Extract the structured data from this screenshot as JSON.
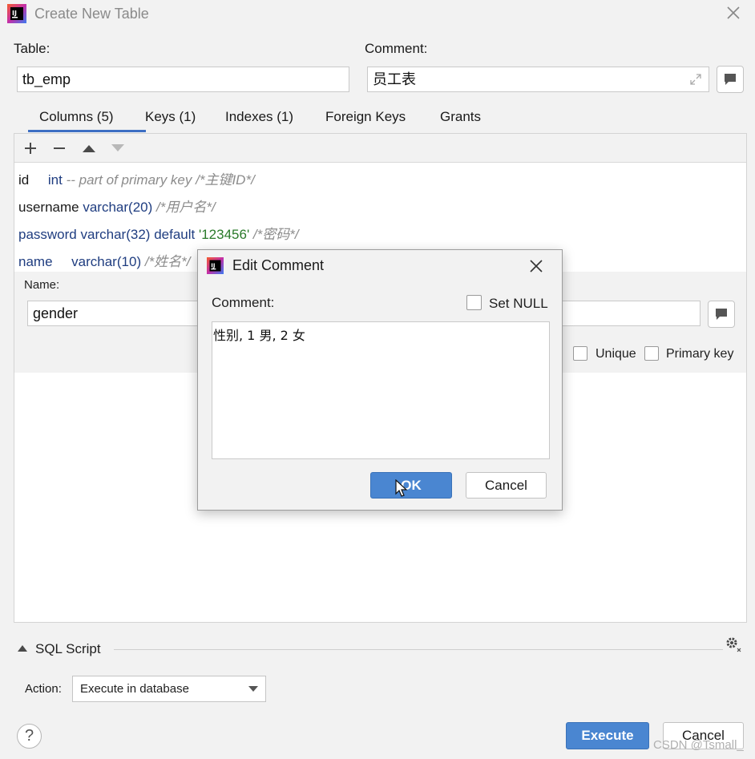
{
  "window": {
    "title": "Create New Table"
  },
  "table": {
    "label": "Table:",
    "value": "tb_emp"
  },
  "comment": {
    "label": "Comment:",
    "value": "员工表"
  },
  "tabs": [
    {
      "label": "Columns (5)"
    },
    {
      "label": "Keys (1)"
    },
    {
      "label": "Indexes (1)"
    },
    {
      "label": "Foreign Keys"
    },
    {
      "label": "Grants"
    }
  ],
  "columns": [
    {
      "name": "id",
      "type": "int",
      "extra": "-- part of primary key",
      "comment": "/*主键ID*/"
    },
    {
      "name": "username",
      "type": "varchar",
      "size": "20",
      "comment": "/*用户名*/"
    },
    {
      "name": "password",
      "type": "varchar",
      "size": "32",
      "default_kw": "default",
      "default_val": "'123456'",
      "comment": "/*密码*/"
    },
    {
      "name": "name",
      "type": "varchar",
      "size": "10",
      "comment": "/*姓名*/"
    }
  ],
  "details": {
    "name_label": "Name:",
    "name_value": "gender",
    "unique_label": "Unique",
    "primary_key_label": "Primary key"
  },
  "sql_script": {
    "label": "SQL Script"
  },
  "action": {
    "label": "Action:",
    "value": "Execute in database"
  },
  "buttons": {
    "execute": "Execute",
    "cancel": "Cancel",
    "help": "?"
  },
  "dialog": {
    "title": "Edit Comment",
    "comment_label": "Comment:",
    "set_null_label": "Set NULL",
    "text": "性别, 1 男, 2 女",
    "ok": "OK",
    "cancel": "Cancel"
  },
  "watermark": "CSDN @Tsmall_",
  "colors": {
    "accent": "#4a86d1",
    "tab_underline": "#3d6fc3",
    "keyword": "#1f3d80",
    "string": "#2a7a2a",
    "comment": "#8c8c8c"
  }
}
